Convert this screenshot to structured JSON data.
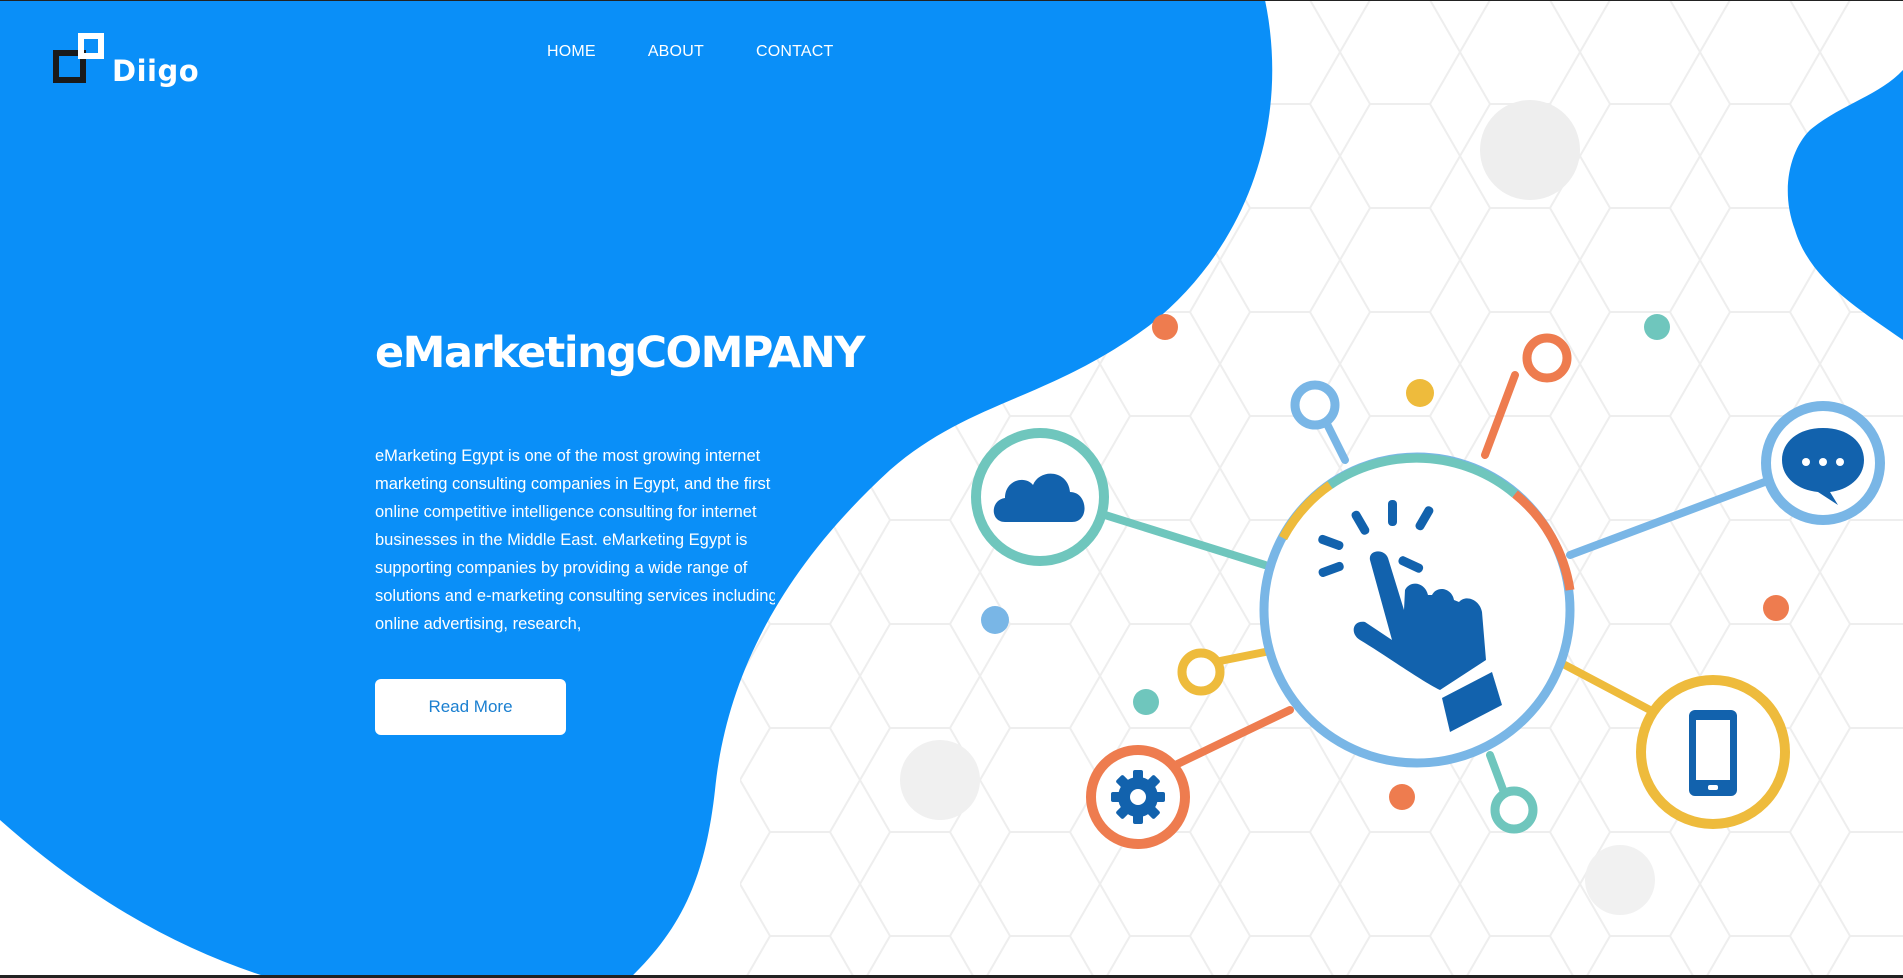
{
  "brand": {
    "name": "Diigo"
  },
  "nav": {
    "items": [
      "HOME",
      "ABOUT",
      "CONTACT"
    ]
  },
  "hero": {
    "title": "eMarketingCOMPANY",
    "description_lines": [
      "eMarketing Egypt is one of the most growing internet",
      "marketing consulting companies in Egypt, and the first",
      "online competitive intelligence consulting for internet",
      "businesses in the Middle East. eMarketing Egypt is",
      "supporting companies by providing a wide range of",
      "solutions and e-marketing consulting services including",
      "online advertising, research,"
    ],
    "button_label": "Read More"
  },
  "illustration": {
    "nodes": [
      "cloud-icon",
      "chat-icon",
      "gear-icon",
      "smartphone-icon",
      "pointer-hand-icon"
    ]
  },
  "colors": {
    "primary_blue": "#0a8ff8",
    "teal": "#6fc6bd",
    "orange": "#ee7c4f",
    "yellow": "#eebb3c",
    "light_blue": "#79b6e6",
    "dark_blue": "#1262ad"
  }
}
